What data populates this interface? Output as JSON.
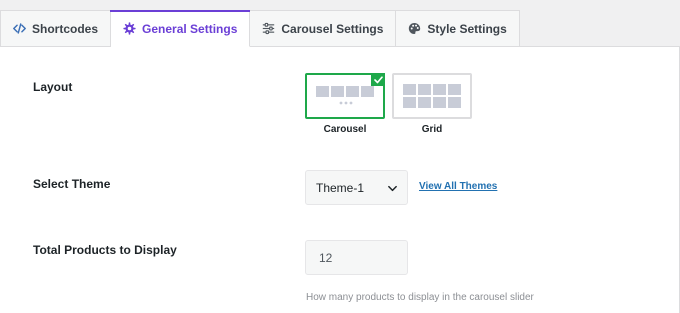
{
  "tabs": [
    {
      "label": "Shortcodes",
      "icon": "code-icon",
      "active": false
    },
    {
      "label": "General Settings",
      "icon": "gear-icon",
      "active": true
    },
    {
      "label": "Carousel Settings",
      "icon": "sliders-icon",
      "active": false
    },
    {
      "label": "Style Settings",
      "icon": "palette-icon",
      "active": false
    }
  ],
  "settings": {
    "layout": {
      "label": "Layout",
      "options": [
        {
          "caption": "Carousel",
          "selected": true
        },
        {
          "caption": "Grid",
          "selected": false
        }
      ]
    },
    "theme": {
      "label": "Select Theme",
      "value": "Theme-1",
      "link": "View All Themes"
    },
    "total_products": {
      "label": "Total Products to Display",
      "value": "12",
      "help": "How many products to display in the carousel slider"
    }
  },
  "colors": {
    "accent": "#6b3fd6",
    "selected_border": "#1ea84a",
    "link": "#2271b1"
  }
}
